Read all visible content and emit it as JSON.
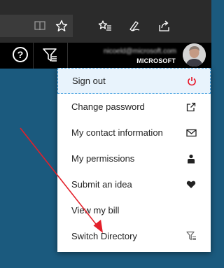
{
  "browser": {
    "icons": [
      "reading-view-icon",
      "favorite-star-icon",
      "favorites-hub-icon",
      "web-note-pen-icon",
      "share-icon"
    ]
  },
  "header": {
    "help_label": "?",
    "directory_icon": "directory-filter-icon",
    "account_email": "nicoeld@microsoft.com",
    "account_org": "MICROSOFT",
    "avatar": "user-avatar"
  },
  "menu": {
    "items": [
      {
        "label": "Sign out",
        "icon": "power-icon"
      },
      {
        "label": "Change password",
        "icon": "external-link-icon"
      },
      {
        "label": "My contact information",
        "icon": "envelope-icon"
      },
      {
        "label": "My permissions",
        "icon": "user-permissions-icon"
      },
      {
        "label": "Submit an idea",
        "icon": "heart-icon"
      },
      {
        "label": "View my bill",
        "icon": ""
      },
      {
        "label": "Switch Directory",
        "icon": "switch-directory-icon"
      }
    ]
  },
  "colors": {
    "background": "#1b5a7e",
    "header": "#000000",
    "browser_chrome": "#2b2b2b",
    "signout_accent": "#e81123",
    "arrow": "#e3202a"
  }
}
